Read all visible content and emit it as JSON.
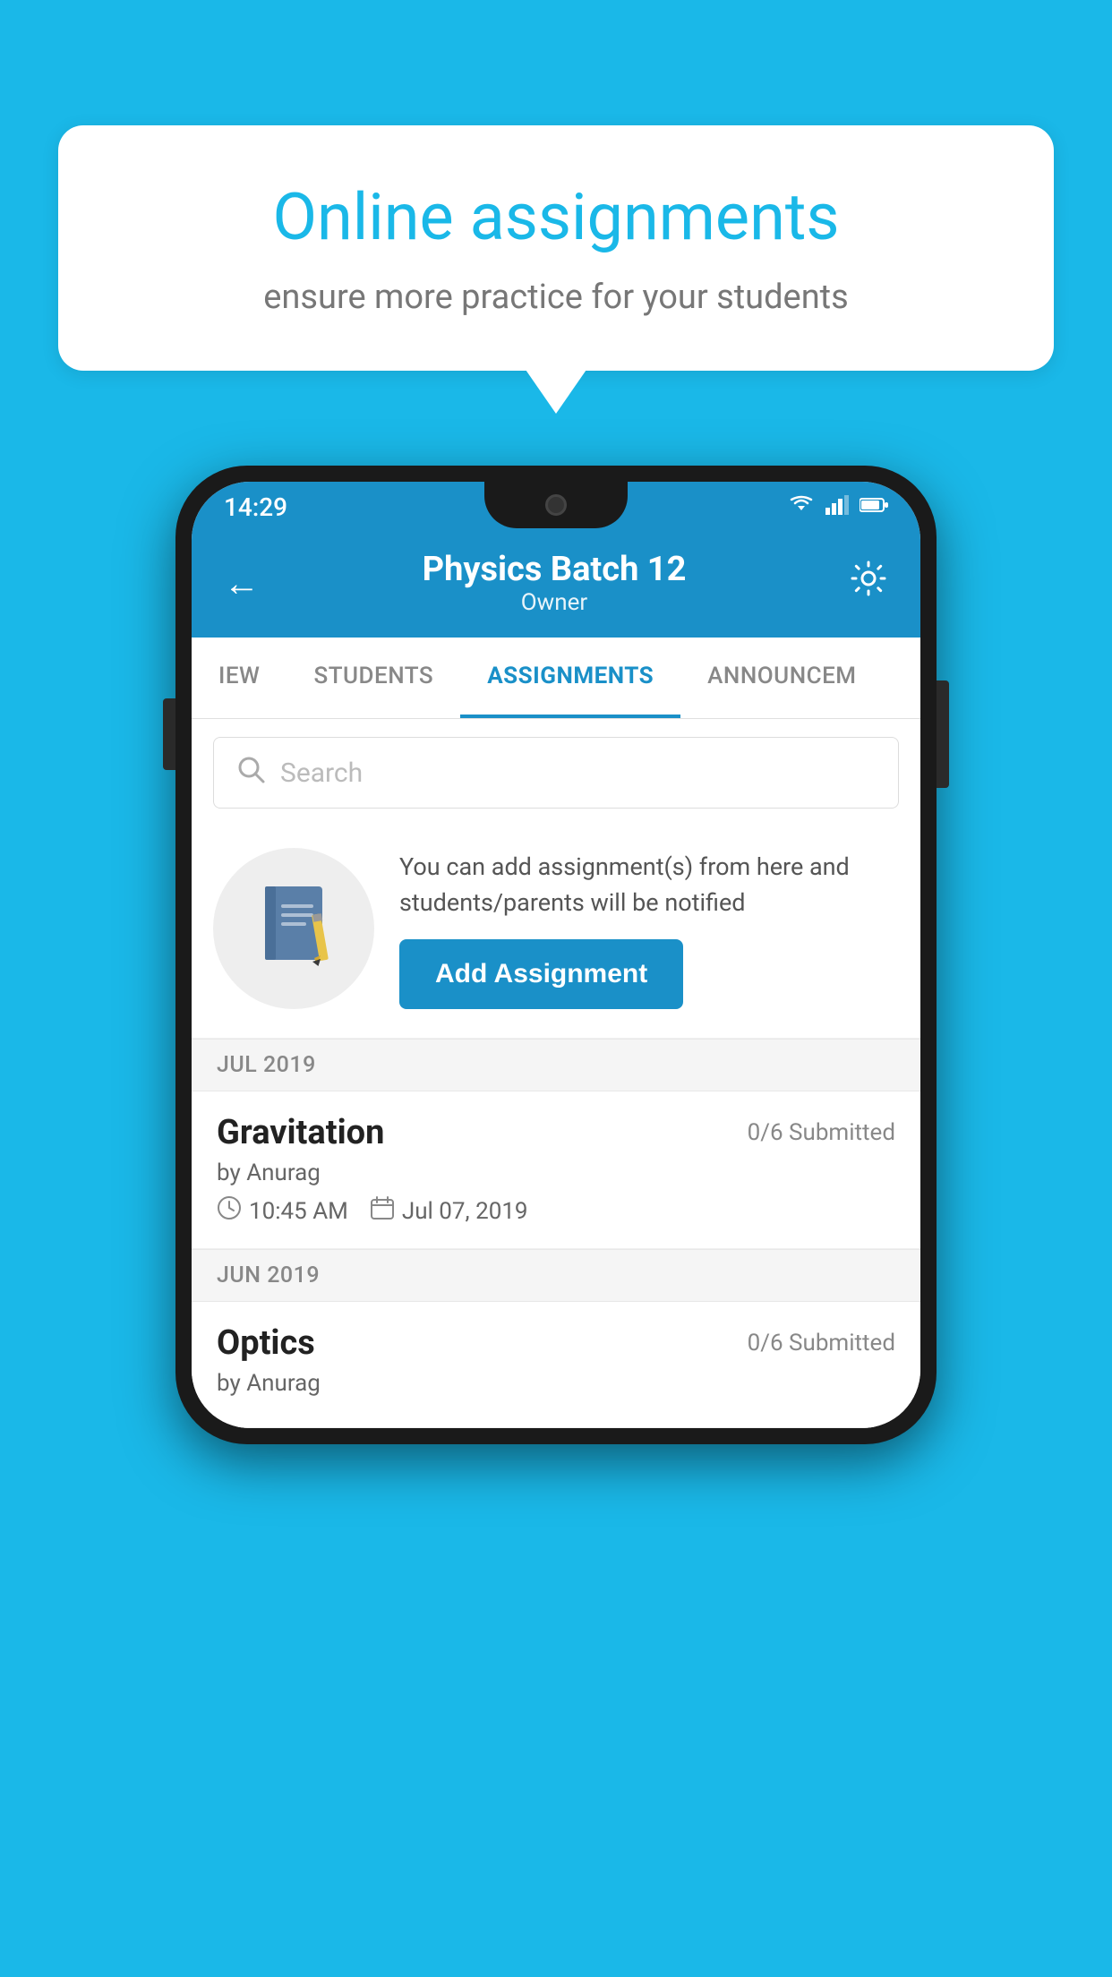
{
  "background_color": "#1AB8E8",
  "speech_bubble": {
    "title": "Online assignments",
    "subtitle": "ensure more practice for your students"
  },
  "phone": {
    "status_bar": {
      "time": "14:29",
      "icons": [
        "wifi",
        "signal",
        "battery"
      ]
    },
    "header": {
      "title": "Physics Batch 12",
      "subtitle": "Owner",
      "back_label": "←",
      "settings_label": "⚙"
    },
    "tabs": [
      {
        "label": "IEW",
        "active": false
      },
      {
        "label": "STUDENTS",
        "active": false
      },
      {
        "label": "ASSIGNMENTS",
        "active": true
      },
      {
        "label": "ANNOUNCEM",
        "active": false
      }
    ],
    "search": {
      "placeholder": "Search"
    },
    "info_card": {
      "text": "You can add assignment(s) from here and students/parents will be notified",
      "button_label": "Add Assignment"
    },
    "month_sections": [
      {
        "month": "JUL 2019",
        "assignments": [
          {
            "name": "Gravitation",
            "submitted": "0/6 Submitted",
            "by": "by Anurag",
            "time": "10:45 AM",
            "date": "Jul 07, 2019"
          }
        ]
      },
      {
        "month": "JUN 2019",
        "assignments": [
          {
            "name": "Optics",
            "submitted": "0/6 Submitted",
            "by": "by Anurag",
            "time": "",
            "date": ""
          }
        ]
      }
    ]
  }
}
